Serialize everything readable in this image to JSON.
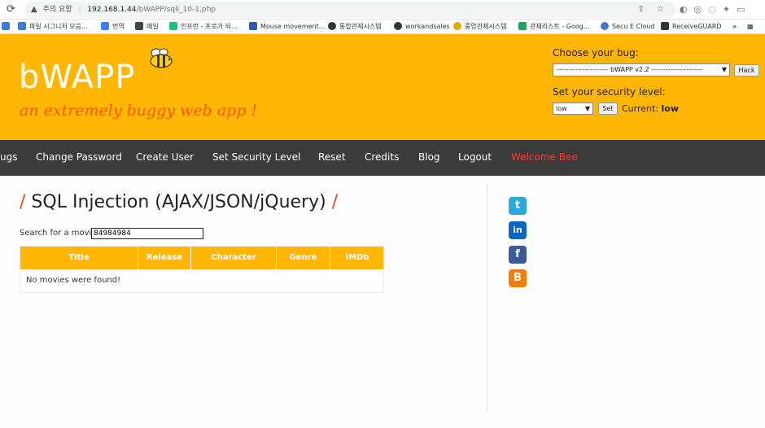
{
  "browser": {
    "security_label": "주의 요함",
    "url_host": "192.168.1.44",
    "url_path": "/bWAPP/sqli_10-1.php",
    "bookmarks": [
      {
        "label": "파일 시그니처 모음...",
        "color": "#3d7bd6"
      },
      {
        "label": "번역",
        "color": "#3b82f6"
      },
      {
        "label": "메일",
        "color": "#444444"
      },
      {
        "label": "인프런 - 프로가 되...",
        "color": "#1dc078"
      },
      {
        "label": "Mouse movement...",
        "color": "#2a5caa"
      },
      {
        "label": "통합관제시스템",
        "color": "#333333"
      },
      {
        "label": "workandsales",
        "color": "#333333"
      },
      {
        "label": "중앙관제시스템",
        "color": "#e0a800"
      },
      {
        "label": "관제리스트 - Goog...",
        "color": "#1fa463"
      },
      {
        "label": "Secu E Cloud",
        "color": "#4a76c7"
      },
      {
        "label": "ReceiveGUARD",
        "color": "#333333"
      }
    ]
  },
  "header": {
    "logo": "bWAPP",
    "tagline": "an extremely buggy web app !",
    "bug_label": "Choose your bug:",
    "bug_selected": "---------------------- bWAPP v2.2 ----------------------",
    "hack_button": "Hack",
    "security_label": "Set your security level:",
    "security_selected": "low",
    "set_button": "Set",
    "current_label": "Current:",
    "current_value": "low"
  },
  "nav": {
    "items": [
      "ugs",
      "Change Password",
      "Create User",
      "Set Security Level",
      "Reset",
      "Credits",
      "Blog",
      "Logout",
      "Welcome Bee"
    ]
  },
  "main": {
    "title": "SQL Injection (AJAX/JSON/jQuery)",
    "search_label": "Search for a movie:",
    "search_value": "84984984",
    "columns": [
      "Title",
      "Release",
      "Character",
      "Genre",
      "IMDb"
    ],
    "empty_message": "No movies were found!"
  },
  "social": [
    "twitter-icon",
    "linkedin-icon",
    "facebook-icon",
    "blogger-icon"
  ],
  "colors": {
    "header_bg": "#ffb605",
    "nav_bg": "#3b3b3b",
    "tagline": "#f05a00",
    "welcome": "#ff3b30"
  }
}
